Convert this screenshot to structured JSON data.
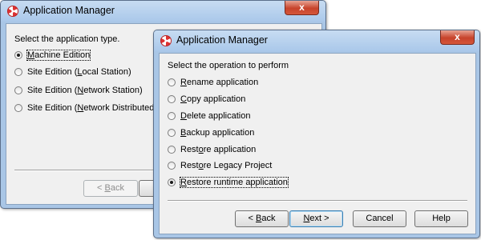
{
  "back_window": {
    "title": "Application Manager",
    "close_symbol": "x",
    "prompt": "Select the application type.",
    "options": [
      {
        "pre": "",
        "u": "M",
        "post": "achine Edition",
        "selected": true
      },
      {
        "pre": "Site Edition (",
        "u": "L",
        "post": "ocal Station)",
        "selected": false
      },
      {
        "pre": "Site Edition (",
        "u": "N",
        "post": "etwork Station)",
        "selected": false
      },
      {
        "pre": "Site Edition (",
        "u": "N",
        "post": "etwork Distributed)",
        "selected": false
      }
    ],
    "back_button": {
      "pre": "< ",
      "u": "B",
      "post": "ack"
    }
  },
  "front_window": {
    "title": "Application Manager",
    "close_symbol": "x",
    "prompt": "Select the operation to perform",
    "options": [
      {
        "pre": "",
        "u": "R",
        "post": "ename application",
        "selected": false
      },
      {
        "pre": "",
        "u": "C",
        "post": "opy application",
        "selected": false
      },
      {
        "pre": "",
        "u": "D",
        "post": "elete application",
        "selected": false
      },
      {
        "pre": "",
        "u": "B",
        "post": "ackup application",
        "selected": false
      },
      {
        "pre": "Rest",
        "u": "o",
        "post": "re application",
        "selected": false
      },
      {
        "pre": "Rest",
        "u": "o",
        "post": "re Legacy Project",
        "selected": false
      },
      {
        "pre": "",
        "u": "R",
        "post": "estore runtime application",
        "selected": true
      }
    ],
    "buttons": {
      "back": {
        "pre": "< ",
        "u": "B",
        "post": "ack"
      },
      "next": {
        "pre": "",
        "u": "N",
        "post": "ext >"
      },
      "cancel": "Cancel",
      "help": "Help"
    }
  },
  "colors": {
    "frame": "#a9c6e6",
    "client": "#f0f0f0",
    "close": "#c7432b"
  },
  "icons": {
    "app": "radiation-app-icon",
    "close": "close-icon"
  }
}
